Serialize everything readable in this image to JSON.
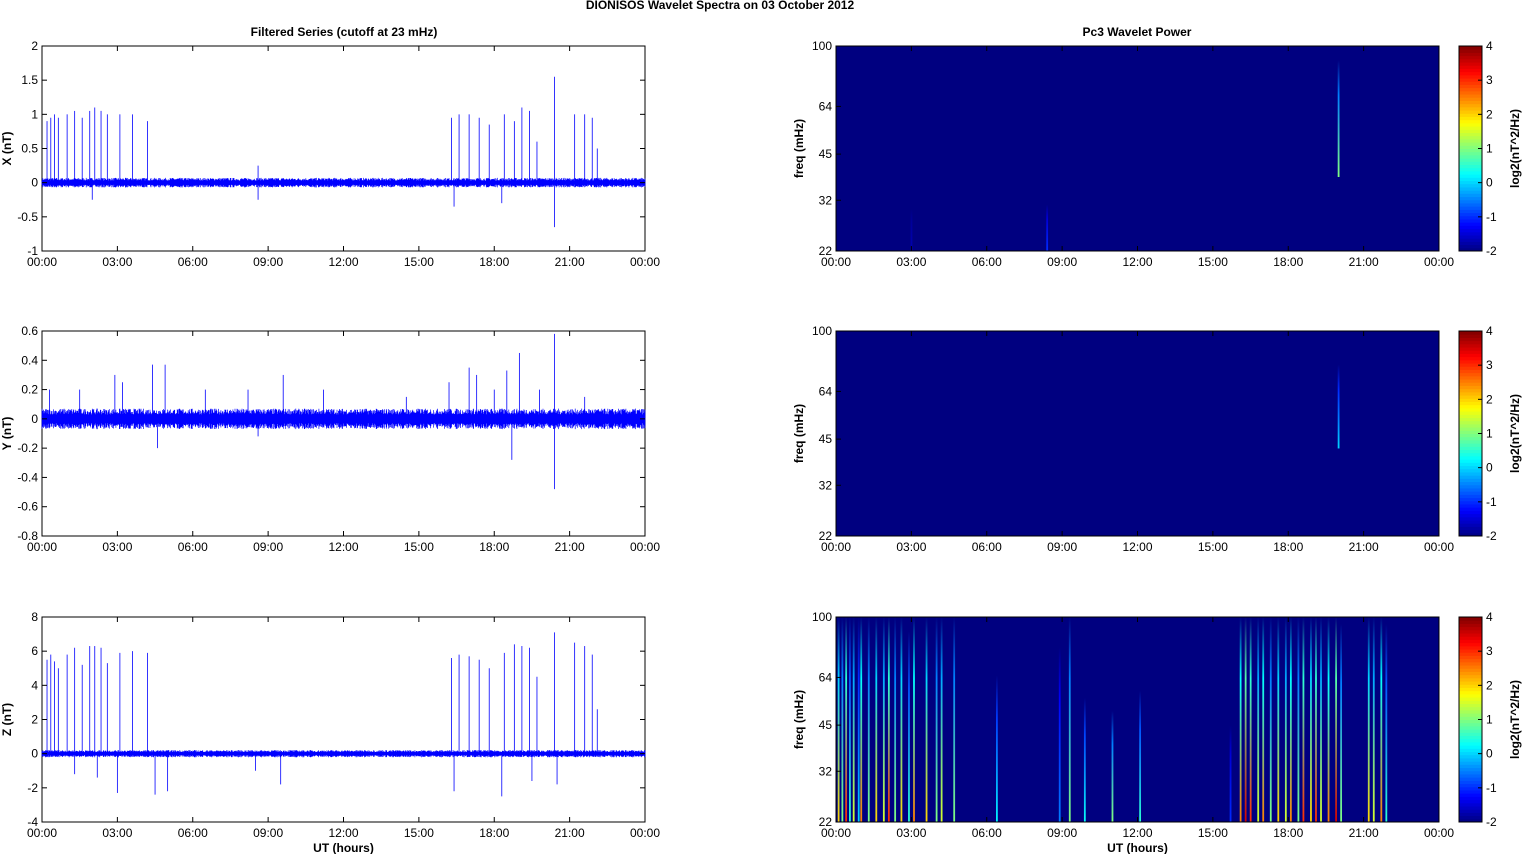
{
  "chart_data": [
    {
      "type": "line",
      "panel": "X",
      "title": "Filtered Series (cutoff at 23 mHz)",
      "ylabel": "X (nT)",
      "xlabel": "",
      "ylim": [
        -1,
        2
      ],
      "yticks": [
        "2",
        "1.5",
        "1",
        "0.5",
        "0",
        "-0.5",
        "-1"
      ],
      "xticks": [
        "00:00",
        "03:00",
        "06:00",
        "09:00",
        "12:00",
        "15:00",
        "18:00",
        "21:00",
        "00:00"
      ],
      "noise_amplitude": 0.05,
      "spikes": [
        [
          0.2,
          0.9
        ],
        [
          0.35,
          0.95
        ],
        [
          0.5,
          1.0
        ],
        [
          0.65,
          0.95
        ],
        [
          1.0,
          1.0
        ],
        [
          1.3,
          1.05
        ],
        [
          1.6,
          0.95
        ],
        [
          1.9,
          1.05
        ],
        [
          2.1,
          1.1
        ],
        [
          2.35,
          1.05
        ],
        [
          2.6,
          1.0
        ],
        [
          3.1,
          1.0
        ],
        [
          3.6,
          1.0
        ],
        [
          4.2,
          0.9
        ],
        [
          8.6,
          0.25
        ],
        [
          16.3,
          0.95
        ],
        [
          16.6,
          1.0
        ],
        [
          17.0,
          1.0
        ],
        [
          17.4,
          0.95
        ],
        [
          17.8,
          0.85
        ],
        [
          18.4,
          1.0
        ],
        [
          18.8,
          0.9
        ],
        [
          19.1,
          1.1
        ],
        [
          19.4,
          1.05
        ],
        [
          19.7,
          0.6
        ],
        [
          20.4,
          1.55
        ],
        [
          21.2,
          1.0
        ],
        [
          21.6,
          1.0
        ],
        [
          21.9,
          0.95
        ],
        [
          22.1,
          0.5
        ],
        [
          16.4,
          -0.35
        ],
        [
          18.3,
          -0.3
        ],
        [
          20.4,
          -0.65
        ],
        [
          2.0,
          -0.25
        ],
        [
          8.6,
          -0.25
        ]
      ]
    },
    {
      "type": "line",
      "panel": "Y",
      "ylabel": "Y (nT)",
      "xlabel": "",
      "ylim": [
        -0.8,
        0.6
      ],
      "yticks": [
        "0.6",
        "0.4",
        "0.2",
        "0",
        "-0.2",
        "-0.4",
        "-0.6",
        "-0.8"
      ],
      "xticks": [
        "00:00",
        "03:00",
        "06:00",
        "09:00",
        "12:00",
        "15:00",
        "18:00",
        "21:00",
        "00:00"
      ],
      "noise_amplitude": 0.05,
      "spikes": [
        [
          0.3,
          0.2
        ],
        [
          1.5,
          0.2
        ],
        [
          2.9,
          0.3
        ],
        [
          3.2,
          0.25
        ],
        [
          4.4,
          0.37
        ],
        [
          4.9,
          0.37
        ],
        [
          6.5,
          0.2
        ],
        [
          8.2,
          0.2
        ],
        [
          9.6,
          0.3
        ],
        [
          11.2,
          0.2
        ],
        [
          14.5,
          0.15
        ],
        [
          16.2,
          0.25
        ],
        [
          17.0,
          0.35
        ],
        [
          17.3,
          0.3
        ],
        [
          18.0,
          0.2
        ],
        [
          18.5,
          0.33
        ],
        [
          19.0,
          0.45
        ],
        [
          19.8,
          0.2
        ],
        [
          20.4,
          0.58
        ],
        [
          21.6,
          0.15
        ],
        [
          4.6,
          -0.2
        ],
        [
          18.7,
          -0.28
        ],
        [
          20.4,
          -0.48
        ],
        [
          8.6,
          -0.12
        ]
      ]
    },
    {
      "type": "line",
      "panel": "Z",
      "ylabel": "Z (nT)",
      "xlabel": "UT (hours)",
      "ylim": [
        -4,
        8
      ],
      "yticks": [
        "8",
        "6",
        "4",
        "2",
        "0",
        "-2",
        "-4"
      ],
      "xticks": [
        "00:00",
        "03:00",
        "06:00",
        "09:00",
        "12:00",
        "15:00",
        "18:00",
        "21:00",
        "00:00"
      ],
      "noise_amplitude": 0.15,
      "spikes": [
        [
          0.2,
          5.5
        ],
        [
          0.35,
          5.8
        ],
        [
          0.5,
          5.4
        ],
        [
          0.65,
          5.0
        ],
        [
          1.0,
          5.8
        ],
        [
          1.3,
          6.2
        ],
        [
          1.6,
          5.2
        ],
        [
          1.9,
          6.3
        ],
        [
          2.1,
          6.3
        ],
        [
          2.35,
          6.2
        ],
        [
          2.6,
          5.3
        ],
        [
          3.1,
          5.9
        ],
        [
          3.6,
          6.0
        ],
        [
          4.2,
          5.9
        ],
        [
          16.3,
          5.6
        ],
        [
          16.6,
          5.8
        ],
        [
          17.0,
          5.7
        ],
        [
          17.4,
          5.5
        ],
        [
          17.8,
          5.0
        ],
        [
          18.4,
          5.9
        ],
        [
          18.8,
          6.4
        ],
        [
          19.1,
          6.3
        ],
        [
          19.4,
          6.2
        ],
        [
          19.7,
          4.5
        ],
        [
          20.4,
          7.1
        ],
        [
          21.2,
          6.5
        ],
        [
          21.6,
          6.3
        ],
        [
          21.9,
          5.8
        ],
        [
          22.1,
          2.6
        ],
        [
          3.0,
          -2.3
        ],
        [
          4.5,
          -2.4
        ],
        [
          5.0,
          -2.2
        ],
        [
          8.5,
          -1.0
        ],
        [
          9.5,
          -1.8
        ],
        [
          16.4,
          -2.2
        ],
        [
          18.3,
          -2.5
        ],
        [
          19.5,
          -1.6
        ],
        [
          20.5,
          -1.8
        ],
        [
          2.2,
          -1.4
        ],
        [
          1.3,
          -1.2
        ]
      ]
    },
    {
      "type": "heatmap",
      "panel": "X",
      "title": "Pc3 Wavelet Power",
      "ylabel": "freq (mHz)",
      "xlabel": "",
      "ylim": [
        22,
        100
      ],
      "yticks": [
        "100",
        "64",
        "45",
        "32",
        "22"
      ],
      "xticks": [
        "00:00",
        "03:00",
        "06:00",
        "09:00",
        "12:00",
        "15:00",
        "18:00",
        "21:00",
        "00:00"
      ],
      "colorbar": {
        "label": "log2(nT^2/Hz)",
        "range": [
          -2,
          4
        ],
        "ticks": [
          "4",
          "3",
          "2",
          "1",
          "0",
          "-1",
          "-2"
        ]
      },
      "background": -2,
      "streaks": [
        [
          8.4,
          22,
          31,
          -1
        ],
        [
          20.0,
          38,
          90,
          1
        ],
        [
          3.0,
          22,
          30,
          -1.7
        ]
      ]
    },
    {
      "type": "heatmap",
      "panel": "Y",
      "ylabel": "freq (mHz)",
      "xlabel": "",
      "ylim": [
        22,
        100
      ],
      "yticks": [
        "100",
        "64",
        "45",
        "32",
        "22"
      ],
      "xticks": [
        "00:00",
        "03:00",
        "06:00",
        "09:00",
        "12:00",
        "15:00",
        "18:00",
        "21:00",
        "00:00"
      ],
      "colorbar": {
        "label": "log2(nT^2/Hz)",
        "range": [
          -2,
          4
        ],
        "ticks": [
          "4",
          "3",
          "2",
          "1",
          "0",
          "-1",
          "-2"
        ]
      },
      "background": -2,
      "streaks": [
        [
          20.0,
          42,
          78,
          0
        ]
      ]
    },
    {
      "type": "heatmap",
      "panel": "Z",
      "ylabel": "freq (mHz)",
      "xlabel": "UT (hours)",
      "ylim": [
        22,
        100
      ],
      "yticks": [
        "100",
        "64",
        "45",
        "32",
        "22"
      ],
      "xticks": [
        "00:00",
        "03:00",
        "06:00",
        "09:00",
        "12:00",
        "15:00",
        "18:00",
        "21:00",
        "00:00"
      ],
      "colorbar": {
        "label": "log2(nT^2/Hz)",
        "range": [
          -2,
          4
        ],
        "ticks": [
          "4",
          "3",
          "2",
          "1",
          "0",
          "-1",
          "-2"
        ]
      },
      "background": -2,
      "streaks": [
        [
          0.1,
          22,
          100,
          2
        ],
        [
          0.25,
          22,
          100,
          1
        ],
        [
          0.4,
          22,
          100,
          3
        ],
        [
          0.55,
          22,
          100,
          0.5
        ],
        [
          0.7,
          22,
          100,
          1.5
        ],
        [
          0.9,
          22,
          100,
          0
        ],
        [
          1.0,
          22,
          100,
          2.5
        ],
        [
          1.3,
          22,
          100,
          1
        ],
        [
          1.6,
          22,
          100,
          2
        ],
        [
          1.9,
          22,
          100,
          1.5
        ],
        [
          2.1,
          22,
          100,
          3
        ],
        [
          2.35,
          22,
          100,
          1
        ],
        [
          2.6,
          22,
          100,
          2
        ],
        [
          2.9,
          22,
          90,
          0.5
        ],
        [
          3.1,
          22,
          100,
          2.5
        ],
        [
          3.6,
          22,
          100,
          2
        ],
        [
          4.0,
          22,
          100,
          1
        ],
        [
          4.2,
          22,
          100,
          1.5
        ],
        [
          4.7,
          22,
          100,
          1
        ],
        [
          6.4,
          22,
          65,
          0.2
        ],
        [
          8.9,
          22,
          80,
          -0.5
        ],
        [
          9.3,
          22,
          100,
          1
        ],
        [
          9.9,
          22,
          55,
          0.3
        ],
        [
          11.0,
          22,
          50,
          1
        ],
        [
          12.1,
          22,
          58,
          0.5
        ],
        [
          15.7,
          22,
          45,
          -1
        ],
        [
          16.1,
          22,
          100,
          2.5
        ],
        [
          16.3,
          22,
          100,
          3.5
        ],
        [
          16.5,
          22,
          100,
          3
        ],
        [
          16.8,
          22,
          100,
          1.5
        ],
        [
          17.0,
          22,
          100,
          2.5
        ],
        [
          17.3,
          22,
          100,
          1
        ],
        [
          17.6,
          22,
          100,
          2
        ],
        [
          17.9,
          22,
          100,
          1.5
        ],
        [
          18.1,
          22,
          100,
          2.5
        ],
        [
          18.4,
          22,
          100,
          1
        ],
        [
          18.6,
          22,
          100,
          3
        ],
        [
          18.9,
          22,
          100,
          2
        ],
        [
          19.1,
          22,
          100,
          3
        ],
        [
          19.3,
          22,
          100,
          1.5
        ],
        [
          19.6,
          22,
          100,
          2.5
        ],
        [
          19.9,
          22,
          100,
          3.5
        ],
        [
          20.1,
          22,
          95,
          1
        ],
        [
          21.2,
          22,
          100,
          2
        ],
        [
          21.4,
          22,
          100,
          1.5
        ],
        [
          21.7,
          22,
          100,
          2.5
        ],
        [
          21.9,
          22,
          95,
          0.5
        ]
      ]
    }
  ],
  "figure_title": "DIONISOS Wavelet Spectra on 03 October   2012",
  "left_title": "Filtered Series (cutoff at 23 mHz)",
  "right_title": "Pc3 Wavelet Power",
  "xlabel": "UT (hours)",
  "colors": {
    "trace": "#0000ff",
    "background": "#00008f"
  }
}
